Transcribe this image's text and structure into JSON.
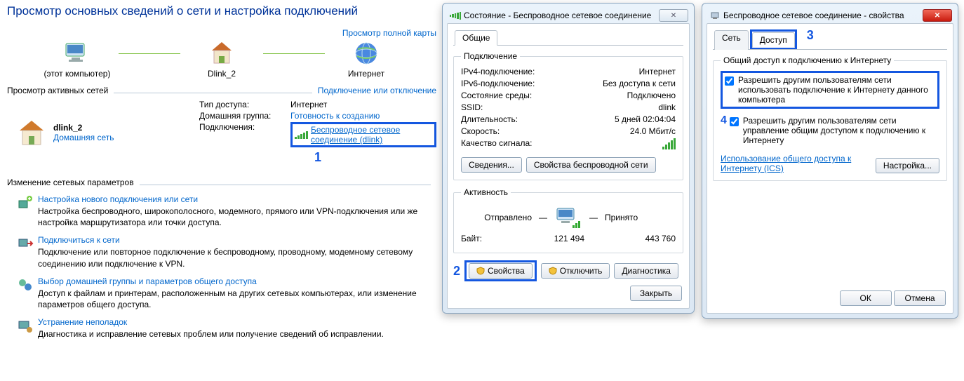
{
  "net_center": {
    "title": "Просмотр основных сведений о сети и настройка подключений",
    "map_link": "Просмотр полной карты",
    "map": {
      "this_pc": "(этот компьютер)",
      "router": "Dlink_2",
      "internet": "Интернет"
    },
    "active_header": "Просмотр активных сетей",
    "active_link": "Подключение или отключение",
    "network": {
      "name": "dlink_2",
      "type_link": "Домашняя сеть",
      "rows": {
        "access_label": "Тип доступа:",
        "access_value": "Интернет",
        "homegroup_label": "Домашняя группа:",
        "homegroup_value": "Готовность к созданию",
        "conn_label": "Подключения:",
        "conn_value": "Беспроводное сетевое соединение (dlink)"
      }
    },
    "step1": "1",
    "change_header": "Изменение сетевых параметров",
    "tasks": [
      {
        "title": "Настройка нового подключения или сети",
        "desc": "Настройка беспроводного, широкополосного, модемного, прямого или VPN-подключения или же настройка маршрутизатора или точки доступа."
      },
      {
        "title": "Подключиться к сети",
        "desc": "Подключение или повторное подключение к беспроводному, проводному, модемному сетевому соединению или подключение к VPN."
      },
      {
        "title": "Выбор домашней группы и параметров общего доступа",
        "desc": "Доступ к файлам и принтерам, расположенным на других сетевых компьютерах, или изменение параметров общего доступа."
      },
      {
        "title": "Устранение неполадок",
        "desc": "Диагностика и исправление сетевых проблем или получение сведений об исправлении."
      }
    ]
  },
  "status": {
    "title": "Состояние - Беспроводное сетевое соединение",
    "tab_general": "Общие",
    "grp_conn": "Подключение",
    "rows": {
      "ipv4_l": "IPv4-подключение:",
      "ipv4_v": "Интернет",
      "ipv6_l": "IPv6-подключение:",
      "ipv6_v": "Без доступа к сети",
      "media_l": "Состояние среды:",
      "media_v": "Подключено",
      "ssid_l": "SSID:",
      "ssid_v": "dlink",
      "dur_l": "Длительность:",
      "dur_v": "5 дней 02:04:04",
      "speed_l": "Скорость:",
      "speed_v": "24.0 Мбит/с",
      "sig_l": "Качество сигнала:"
    },
    "btn_details": "Сведения...",
    "btn_wprops": "Свойства беспроводной сети",
    "grp_activity": "Активность",
    "act_sent": "Отправлено",
    "act_dash": "—",
    "act_recv": "Принято",
    "act_bytes_l": "Байт:",
    "act_sent_v": "121 494",
    "act_recv_v": "443 760",
    "btn_props": "Свойства",
    "btn_disable": "Отключить",
    "btn_diag": "Диагностика",
    "btn_close": "Закрыть",
    "step2": "2"
  },
  "props": {
    "title": "Беспроводное сетевое соединение - свойства",
    "tab_net": "Сеть",
    "tab_share": "Доступ",
    "step3": "3",
    "grp_ics": "Общий доступ к подключению к Интернету",
    "chk1": "Разрешить другим пользователям сети использовать подключение к Интернету данного компьютера",
    "chk2": "Разрешить другим пользователям сети управление общим доступом к подключению к Интернету",
    "step4": "4",
    "link_ics": "Использование общего доступа к Интернету (ICS)",
    "btn_settings": "Настройка...",
    "btn_ok": "ОК",
    "btn_cancel": "Отмена"
  }
}
